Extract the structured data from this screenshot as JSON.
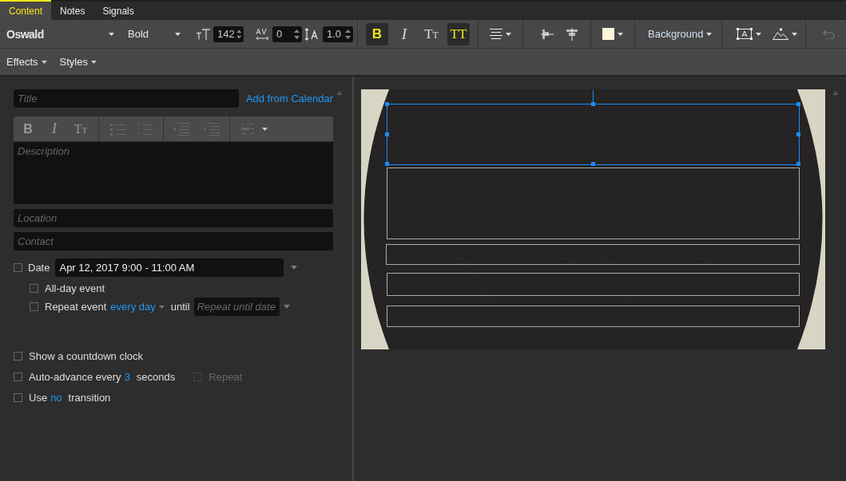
{
  "tabs": [
    {
      "label": "Content",
      "selected": true
    },
    {
      "label": "Notes",
      "selected": false
    },
    {
      "label": "Signals",
      "selected": false
    }
  ],
  "toolbar": {
    "font": "Oswald",
    "weight": "Bold",
    "size": "142",
    "tracking": "0",
    "leading": "1.0",
    "style_buttons": [
      {
        "label": "B",
        "kind": "bold",
        "selected": true
      },
      {
        "label": "I",
        "kind": "italic",
        "selected": false
      },
      {
        "label": "Tt",
        "kind": "smallcaps",
        "selected": false
      },
      {
        "label": "TT",
        "kind": "caps",
        "selected": true
      }
    ],
    "background_menu": "Background"
  },
  "menus": [
    "Effects",
    "Styles"
  ],
  "form": {
    "title_placeholder": "Title",
    "calendar_link": "Add from Calendar",
    "editor_buttons": [
      {
        "label": "B",
        "kind": "bold"
      },
      {
        "label": "I",
        "kind": "italic"
      },
      {
        "label": "Tt",
        "kind": "smallcaps"
      }
    ],
    "description_placeholder": "Description",
    "location_placeholder": "Location",
    "contact_placeholder": "Contact",
    "date": {
      "label": "Date",
      "checked": false,
      "value": "Apr 12, 2017 9:00 - 11:00 AM"
    },
    "all_day": {
      "label": "All-day event",
      "checked": false
    },
    "repeat": {
      "label": "Repeat event",
      "checked": false,
      "frequency": "every day",
      "until": "until",
      "until_placeholder": "Repeat until date"
    },
    "countdown": {
      "label": "Show a countdown clock",
      "checked": false
    },
    "auto_advance": {
      "label": "Auto-advance every",
      "value": "3",
      "unit": "seconds",
      "checked": false,
      "repeat_label": "Repeat",
      "repeat_checked": false,
      "repeat_disabled": true
    },
    "transition": {
      "label": "Use",
      "value": "no",
      "suffix": "transition",
      "checked": false
    }
  },
  "slide": {
    "text_boxes": [
      {
        "selected": true
      },
      {
        "selected": false
      },
      {
        "selected": false
      },
      {
        "selected": false
      },
      {
        "selected": false
      }
    ]
  }
}
